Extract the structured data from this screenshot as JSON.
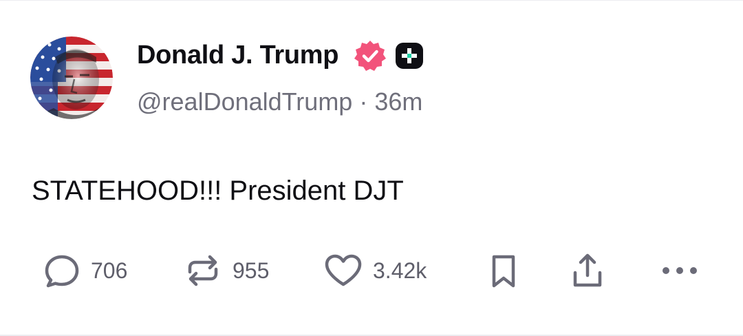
{
  "post": {
    "author": {
      "display_name": "Donald J. Trump",
      "handle": "@realDonaldTrump",
      "separator": "·",
      "time": "36m",
      "verified_badge_color": "#f2537b",
      "avatar_icon": "flag-portrait-avatar"
    },
    "text": "STATEHOOD!!! President DJT",
    "actions": {
      "reply_count": "706",
      "repost_count": "955",
      "like_count": "3.42k"
    }
  },
  "colors": {
    "text": "#0f0f14",
    "muted": "#6f6f7b",
    "icon": "#6b6b78"
  }
}
